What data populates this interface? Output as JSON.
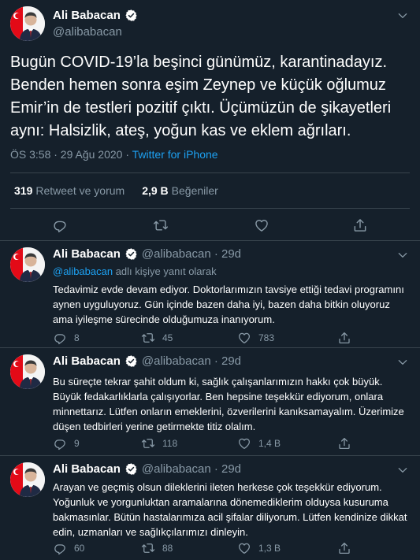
{
  "main_tweet": {
    "author_name": "Ali Babacan",
    "handle": "@alibabacan",
    "text": "Bugün COVID-19’la beşinci günümüz, karantinadayız. Benden hemen sonra eşim Zeynep ve küçük oğlumuz Emir’in de testleri pozitif çıktı. Üçümüzün de şikayetleri aynı: Halsizlik, ateş, yoğun kas ve eklem ağrıları.",
    "timestamp": "ÖS 3:58 · 29 Ağu 2020 · ",
    "source": "Twitter for iPhone",
    "retweets_count": "319",
    "retweets_label": "Retweet ve yorum",
    "likes_count": "2,9 B",
    "likes_label": "Beğeniler"
  },
  "replies": [
    {
      "author_name": "Ali Babacan",
      "handle": "@alibabacan · 29d",
      "replying_mention": "@alibabacan",
      "replying_suffix": " adlı kişiye yanıt olarak",
      "text": "Tedavimiz evde devam ediyor. Doktorlarımızın tavsiye ettiği tedavi programını aynen uyguluyoruz. Gün içinde bazen daha iyi, bazen daha bitkin oluyoruz ama iyileşme sürecinde olduğumuza inanıyorum.",
      "reply_count": "8",
      "retweet_count": "45",
      "like_count": "783"
    },
    {
      "author_name": "Ali Babacan",
      "handle": "@alibabacan · 29d",
      "text": "Bu süreçte tekrar şahit oldum ki, sağlık çalışanlarımızın hakkı çok büyük. Büyük fedakarlıklarla çalışıyorlar. Ben hepsine teşekkür ediyorum, onlara minnettarız. Lütfen onların emeklerini, özverilerini kanıksamayalım. Üzerimize düşen tedbirleri yerine getirmekte titiz olalım.",
      "reply_count": "9",
      "retweet_count": "118",
      "like_count": "1,4 B"
    },
    {
      "author_name": "Ali Babacan",
      "handle": "@alibabacan · 29d",
      "text": "Arayan ve geçmiş olsun dileklerini ileten herkese çok teşekkür ediyorum. Yoğunluk ve yorgunluktan aramalarına dönemediklerim olduysa kusuruma bakmasınlar. Bütün hastalarımıza acil şifalar diliyorum. Lütfen kendinize dikkat edin, uzmanları ve sağlıkçılarımızı dinleyin.",
      "reply_count": "60",
      "retweet_count": "88",
      "like_count": "1,3 B"
    }
  ],
  "colors": {
    "background": "#15202b",
    "muted": "#8899a6",
    "accent": "#1da1f2",
    "border": "#38444d",
    "flag_red": "#e30a17"
  },
  "icons": [
    "verified-badge-icon",
    "chevron-down-icon",
    "reply-icon",
    "retweet-icon",
    "like-icon",
    "share-icon"
  ]
}
